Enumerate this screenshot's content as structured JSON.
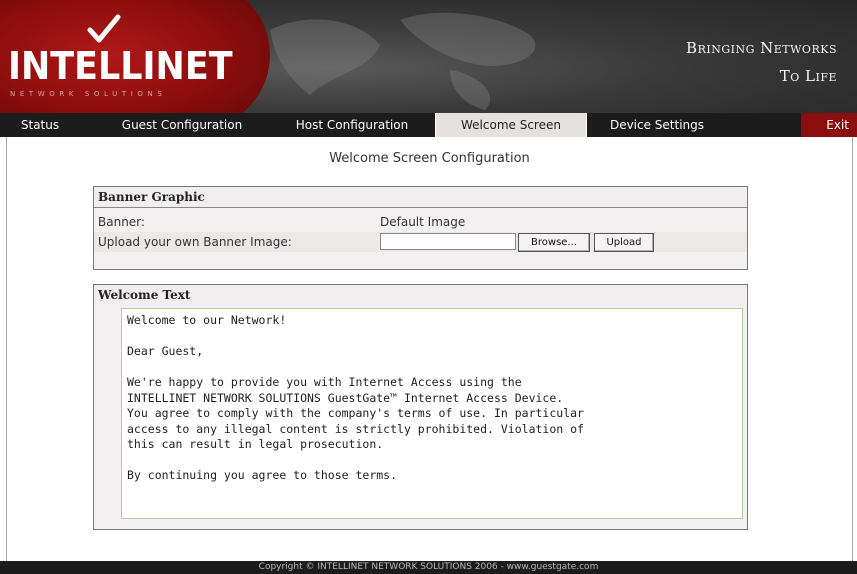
{
  "brand": {
    "logo": "INTELLINET",
    "logo_sub": "NETWORK SOLUTIONS",
    "tagline_line1": "Bringing Networks",
    "tagline_line2": "To Life"
  },
  "nav": {
    "items": [
      "Status",
      "Guest Configuration",
      "Host Configuration",
      "Welcome Screen",
      "Device Settings"
    ],
    "active": "Welcome Screen",
    "exit": "Exit"
  },
  "page": {
    "title": "Welcome Screen Configuration"
  },
  "banner": {
    "header": "Banner Graphic",
    "banner_label": "Banner:",
    "banner_value": "Default Image",
    "upload_label": "Upload your own Banner Image:",
    "upload_value": "",
    "browse_button": "Browse...",
    "upload_button": "Upload"
  },
  "welcome": {
    "header": "Welcome Text",
    "text": "Welcome to our Network!\n\nDear Guest,\n\nWe're happy to provide you with Internet Access using the\nINTELLINET NETWORK SOLUTIONS GuestGate™ Internet Access Device.\nYou agree to comply with the company's terms of use. In particular\naccess to any illegal content is strictly prohibited. Violation of\nthis can result in legal prosecution.\n\nBy continuing you agree to those terms."
  },
  "footer": {
    "text": "Copyright © INTELLINET NETWORK SOLUTIONS 2006 - www.guestgate.com"
  },
  "colors": {
    "brand_red": "#8b0d0d",
    "nav_bg": "#1c1c1c",
    "active_tab": "#e6e1e1"
  }
}
